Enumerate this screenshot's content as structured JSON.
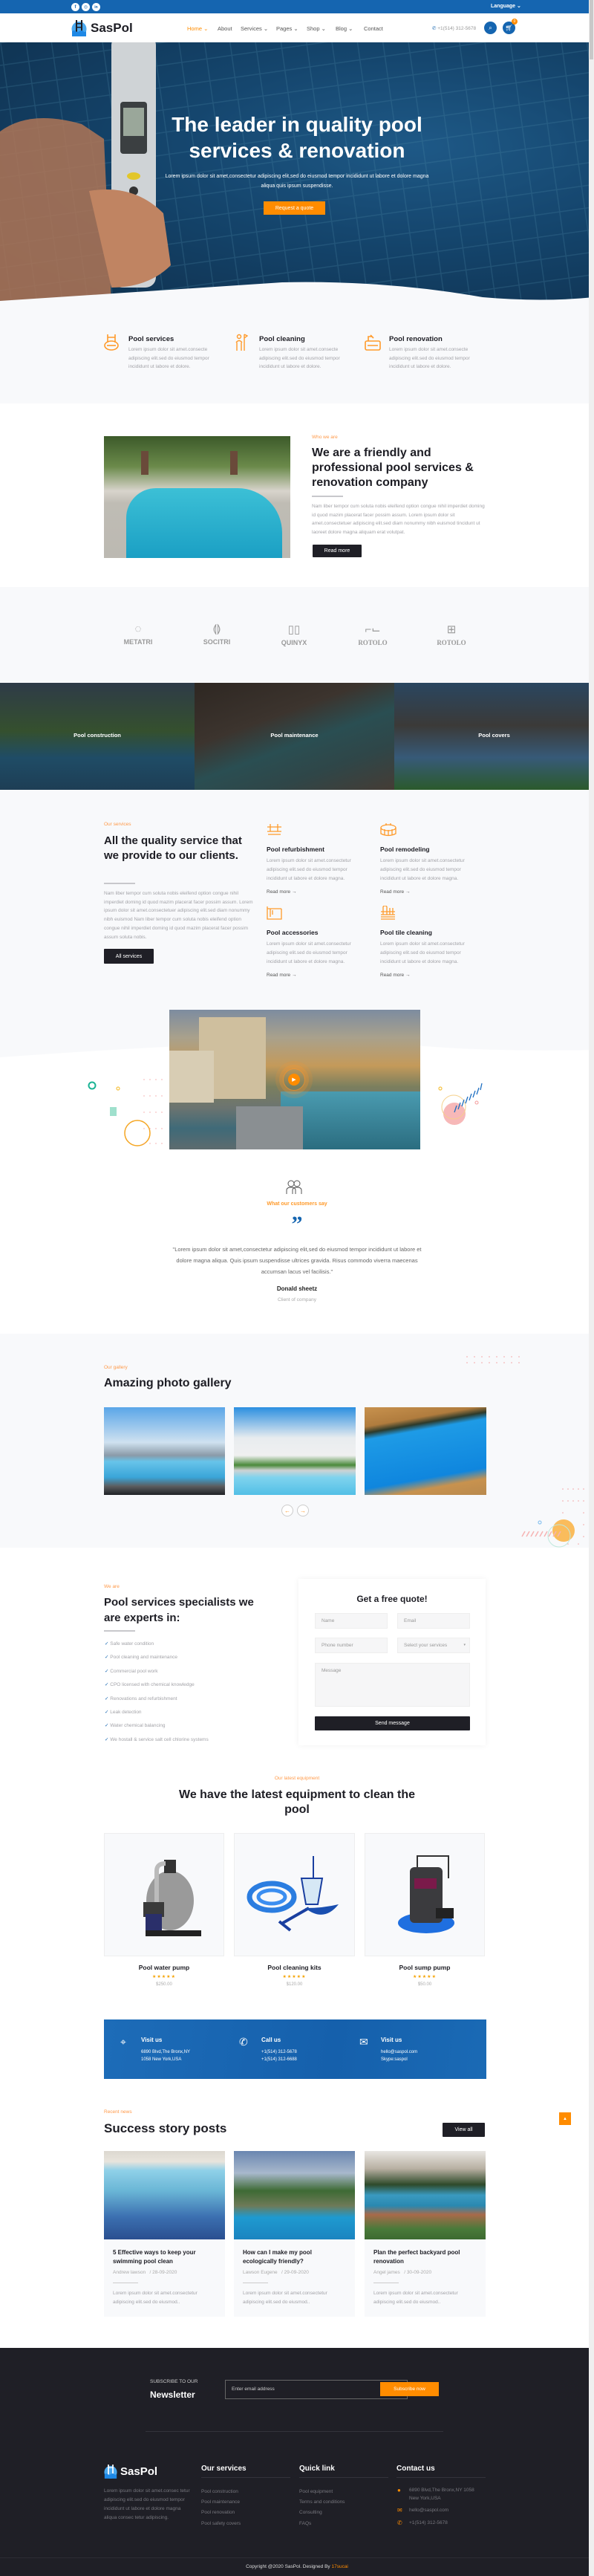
{
  "colors": {
    "primary": "#1565b0",
    "accent": "#ff8c00",
    "dark": "#1f1f26",
    "light_bg": "#f8f9fb"
  },
  "topbar": {
    "social": [
      {
        "icon": "facebook-icon",
        "glyph": "f"
      },
      {
        "icon": "instagram-icon",
        "glyph": "◎"
      },
      {
        "icon": "linkedin-icon",
        "glyph": "in"
      }
    ],
    "language": "Language"
  },
  "nav": {
    "logo": "SasPol",
    "items": [
      "Home",
      "About",
      "Services",
      "Pages",
      "Shop",
      "Blog",
      "Contact"
    ],
    "phone": "+1(514) 312-5678",
    "cart_count": "0"
  },
  "hero": {
    "title_line1": "The leader in quality pool",
    "title_line2": "services & renovation",
    "subtitle": "Lorem ipsum dolor sit amet,consectetur adipiscing elit,sed do eiusmod tempor incididunt ut labore et dolore magna aliqua quis ipsum suspendisse.",
    "button": "Request a quote"
  },
  "features": [
    {
      "title": "Pool services",
      "text": "Lorem ipsum dolor sit amet.consecte adipiscing elit.sed do eiusmod tempor incididunt ut labore et dolore."
    },
    {
      "title": "Pool cleaning",
      "text": "Lorem ipsum dolor sit amet.consecte adipiscing elit.sed do eiusmod tempor incididunt ut labore et dolore."
    },
    {
      "title": "Pool renovation",
      "text": "Lorem ipsum dolor sit amet.consecte adipiscing elit.sed do eiusmod tempor incididunt ut labore et dolore."
    }
  ],
  "about": {
    "label": "Who we are",
    "title": "We are a friendly and professional pool services & renovation company",
    "text": "Nam liber tempor cum soluta nobis eleifend option congue nihil imperdiet doming id quod mazim placerat facer possim assum. Lorem ipsum dolor sit amet.consectetuer adipiscing elit.sed diam nonummy nibh euismod tincidunt ut laoreet dolore magna aliquam erat volutpat.",
    "button": "Read more"
  },
  "brands": [
    "METATRI",
    "SOCITRI",
    "QUINYX",
    "ROTOLO",
    "ROTOLO"
  ],
  "service_panels": [
    "Pool construction",
    "Pool maintenance",
    "Pool covers"
  ],
  "services": {
    "label": "Our services",
    "title": "All the quality service that we provide to our clients.",
    "text": "Nam liber tempor cum soluta nobis eleifend option congue nihil imperdiet doming id quod mazim placerat facer possim assum. Lorem ipsum dolor sit amet.consectetuer adipiscing elit.sed diam nonummy nibh euismod Nam liber tempor cum soluta nobis eleifend option congue nihil imperdiet doming id quod mazim placerat facer possim assum soluta nobis.",
    "button": "All services",
    "read_more": "Read more",
    "items": [
      {
        "title": "Pool refurbishment",
        "text": "Lorem ipsum dolor sit amet.consectetur adipiscing elit.sed do eiusmod tempor incididunt ut labore et dolore magna."
      },
      {
        "title": "Pool remodeling",
        "text": "Lorem ipsum dolor sit amet.consectetur adipiscing elit.sed do eiusmod tempor incididunt ut labore et dolore magna."
      },
      {
        "title": "Pool accessories",
        "text": "Lorem ipsum dolor sit amet.consectetur adipiscing elit.sed do eiusmod tempor incididunt ut labore et dolore magna."
      },
      {
        "title": "Pool tile cleaning",
        "text": "Lorem ipsum dolor sit amet.consectetur adipiscing elit.sed do eiusmod tempor incididunt ut labore et dolore magna."
      }
    ]
  },
  "testimonial": {
    "label": "What our customers say",
    "quote": "\"Lorem ipsum dolor sit amet,consectetur adipiscing elit,sed do eiusmod tempor incididunt ut labore et dolore magna aliqua. Quis ipsum suspendisse ultrices gravida. Risus commodo viverra maecenas accumsan lacus vel facilisis.\"",
    "name": "Donald sheetz",
    "role": "Client of company"
  },
  "gallery": {
    "label": "Our gallery",
    "title": "Amazing photo gallery"
  },
  "experts": {
    "label": "We are",
    "title": "Pool services specialists we are experts in:",
    "items": [
      "Safe water condition",
      "Pool cleaning and maintenance",
      "Commercial pool work",
      "CPO licensed with chemical knowledge",
      "Renovations and refurbishment",
      "Leak detection",
      "Water chemical balancing",
      "We hostall & service salt cell chlorine systems"
    ]
  },
  "quote_form": {
    "title": "Get a free quote!",
    "name": "Name",
    "email": "Email",
    "phone": "Phone number",
    "service": "Select your services",
    "message": "Message",
    "button": "Send message"
  },
  "equipment": {
    "label": "Our latest equipment",
    "title": "We have the latest equipment to clean the pool",
    "products": [
      {
        "name": "Pool water pump",
        "price": "$250.00",
        "rating": 5
      },
      {
        "name": "Pool cleaning kits",
        "price": "$120.00",
        "rating": 5
      },
      {
        "name": "Pool sump pump",
        "price": "$50.00",
        "rating": 5
      }
    ]
  },
  "contact_band": [
    {
      "title": "Visit us",
      "line1": "6890 Blvd,The Bronx,NY",
      "line2": "1058 New York,USA"
    },
    {
      "title": "Call us",
      "line1": "+1(514) 312-5678",
      "line2": "+1(514) 312-6688"
    },
    {
      "title": "Visit us",
      "line1": "hello@saspol.com",
      "line2": "Skype:saspol"
    }
  ],
  "news": {
    "label": "Recent news",
    "title": "Success story posts",
    "button": "View all",
    "posts": [
      {
        "title": "5 Effective ways to keep your swimming pool clean",
        "author": "Andrew lawson",
        "date": "/ 28-09-2020",
        "text": "Lorem ipsum dolor sit amet.consectetur adipiscing elit.sed do eiusmod.."
      },
      {
        "title": "How can I make my pool ecologically friendly?",
        "author": "Lawson Eugene",
        "date": "/ 29-09-2020",
        "text": "Lorem ipsum dolor sit amet.consectetur adipiscing elit.sed do eiusmod.."
      },
      {
        "title": "Plan the perfect backyard pool renovation",
        "author": "Angel james",
        "date": "/ 30-09-2020",
        "text": "Lorem ipsum dolor sit amet.consectetur adipiscing elit.sed do eiusmod.."
      }
    ]
  },
  "footer": {
    "sub_small": "SUBSCRIBE TO OUR",
    "sub_big": "Newsletter",
    "email_placeholder": "Enter email address",
    "sub_button": "Subscribe now",
    "logo": "SasPol",
    "about": "Lorem ipsum dolor sit amet.consec tetur adipiscing elit.sed do eiusmod tempor incididunt ut labore et dolore magna aliqua consec tetur adipiscing.",
    "services_title": "Our services",
    "services": [
      "Pool construction",
      "Pool maintenance",
      "Pool renovation",
      "Pool safety covers"
    ],
    "quick_title": "Quick link",
    "quick": [
      "Pool equipment",
      "Terms and conditions",
      "Consulting",
      "FAQs"
    ],
    "contact_title": "Contact us",
    "address": "6890 Blvd,The Bronx,NY 1058 New York,USA",
    "email": "hello@saspol.com",
    "phone": "+1(514) 312-5678",
    "copyright": "Copyright @2020 SasPol. Designed By ",
    "designer": "17sucai"
  }
}
